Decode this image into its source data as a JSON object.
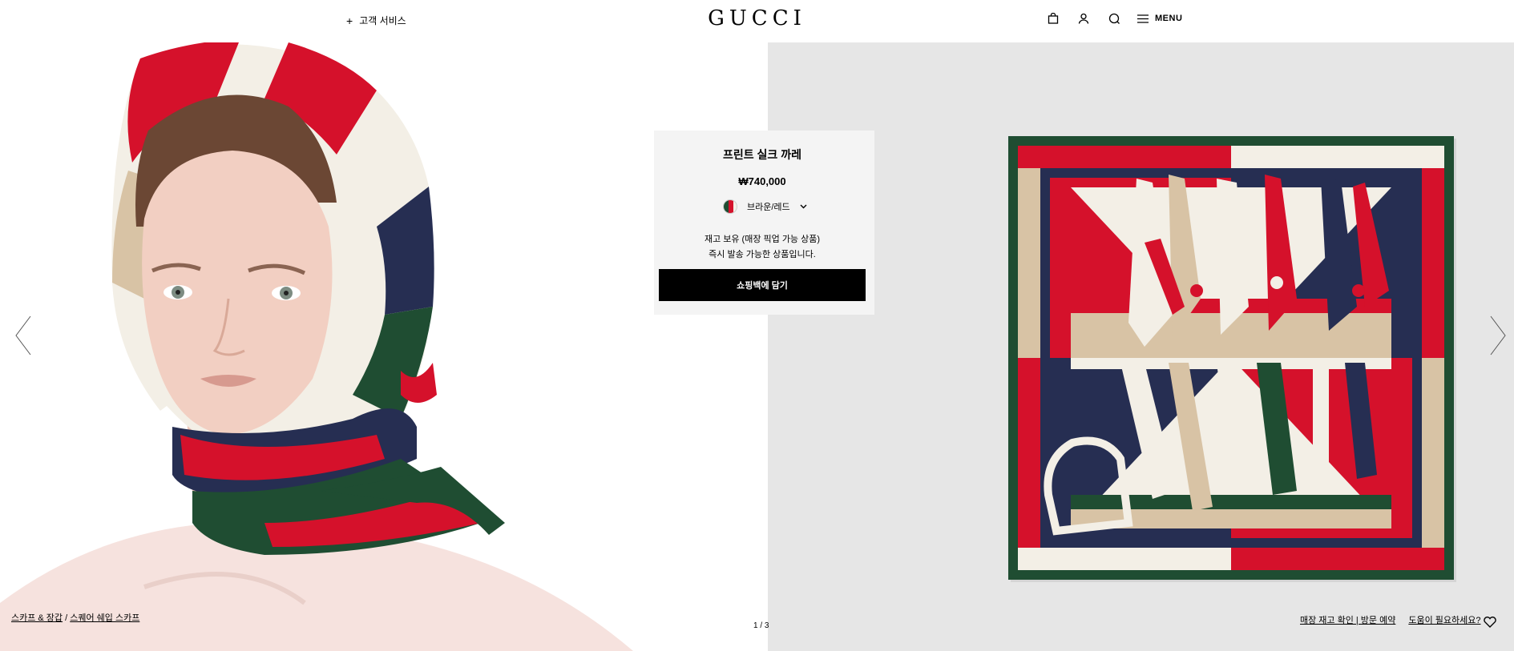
{
  "header": {
    "customer_service": "고객 서비스",
    "logo": "GUCCI",
    "menu_label": "MENU",
    "icons": [
      "bag-icon",
      "user-icon",
      "search-icon",
      "menu-icon"
    ]
  },
  "product": {
    "title": "프린트 실크 까레",
    "price": "₩740,000",
    "color": "브라운/레드",
    "stock_line1": "재고 보유 (매장 픽업 가능 상품)",
    "stock_line2": "즉시 발송 가능한 상품입니다.",
    "add_to_bag": "쇼핑백에 담기"
  },
  "breadcrumb": {
    "level1": "스카프 & 장갑",
    "separator": "/",
    "level2": "스퀘어 쉐입 스카프"
  },
  "pager": "1 / 3",
  "footer_links": {
    "store": "매장 재고 확인 | 방문 예약",
    "help": "도움이 필요하세요?"
  },
  "colors": {
    "red": "#d5112b",
    "navy": "#262e52",
    "green": "#1f4d32",
    "beige": "#d8c3a5",
    "cream": "#f3efe6",
    "background_right": "#e6e6e6"
  }
}
